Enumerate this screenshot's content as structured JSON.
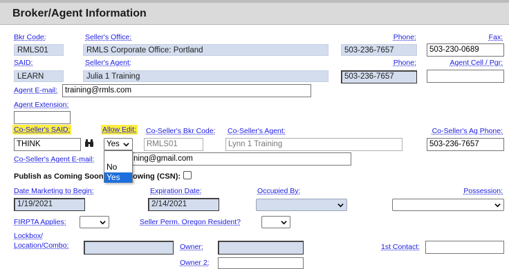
{
  "section_title": "Broker/Agent Information",
  "labels": {
    "bkr_code": "Bkr Code:",
    "sellers_office": "Seller's Office:",
    "phone1": "Phone:",
    "fax": "Fax:",
    "said": "SAID:",
    "sellers_agent": "Seller's Agent:",
    "phone2": "Phone:",
    "agent_cell": "Agent Cell / Pgr:",
    "agent_email": "Agent E-mail:",
    "agent_extension": "Agent Extension:",
    "co_said": "Co-Seller's SAID:",
    "allow_edit": "Allow Edit:",
    "co_bkr_code": "Co-Seller's Bkr Code:",
    "co_agent": "Co-Seller's Agent:",
    "co_ag_phone": "Co-Seller's Ag Phone:",
    "co_agent_email": "Co-Seller's Agent E-mail:",
    "publish_coming_soon": "Publish as Coming Soon",
    "publish_showing": "owing (CSN):",
    "date_marketing": "Date Marketing to Begin:",
    "expiration_date": "Expiration Date:",
    "occupied_by": "Occupied By:",
    "possession": "Possession:",
    "firpta": "FIRPTA Applies:",
    "seller_perm_resident": "Seller Perm. Oregon Resident?",
    "lockbox1": "Lockbox/",
    "lockbox2": "Location/Combo:",
    "owner": "Owner:",
    "owner2": "Owner 2:",
    "first_contact": "1st Contact:"
  },
  "values": {
    "bkr_code": "RMLS01",
    "sellers_office": "RMLS Corporate Office: Portland",
    "phone1": "503-236-7657",
    "fax": "503-230-0689",
    "said": "LEARN",
    "sellers_agent": "Julia 1 Training",
    "phone2": "503-236-7657",
    "agent_cell": "",
    "agent_email": "training@rmls.com",
    "agent_extension": "",
    "co_said": "THINK",
    "allow_edit": "Yes",
    "co_bkr_code": "RMLS01",
    "co_agent": "Lynn 1 Training",
    "co_ag_phone": "503-236-7657",
    "co_agent_email": "ning@gmail.com",
    "date_marketing": "1/19/2021",
    "expiration_date": "2/14/2021",
    "occupied_by": "",
    "possession": "",
    "firpta": "",
    "seller_perm_resident": ""
  },
  "allow_edit_options": [
    "No",
    "Yes"
  ],
  "allow_edit_selected": "Yes",
  "colors": {
    "link_blue": "#1b1be0",
    "highlight_yellow": "#ffef3f",
    "readonly_blue": "#d3ddee",
    "header_gray": "#dadada",
    "option_selected": "#1e6fdc"
  },
  "icons": {
    "lookup": "binoculars-icon",
    "dropdown": "chevron-down-icon"
  }
}
